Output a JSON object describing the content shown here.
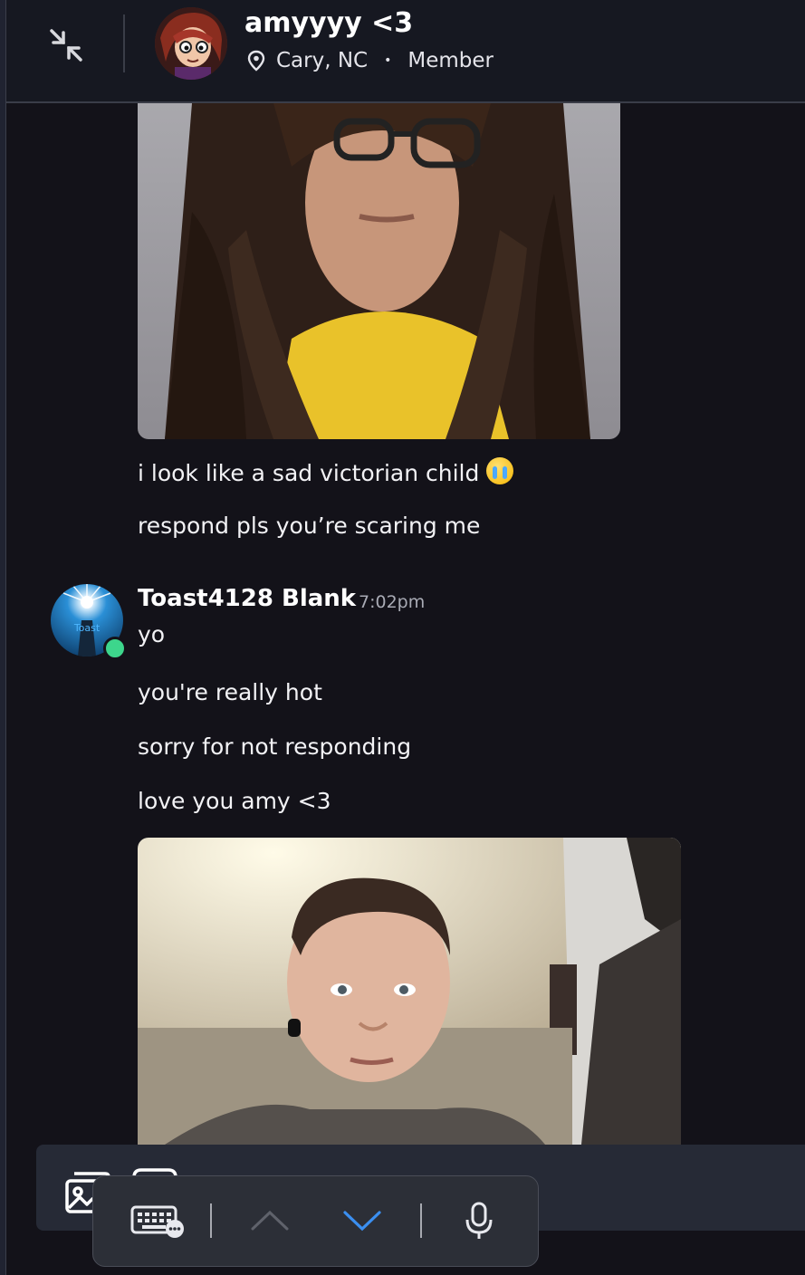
{
  "header": {
    "name": "amyyyy <3",
    "location": "Cary, NC",
    "separator": "•",
    "role": "Member"
  },
  "messages_top": [
    {
      "text": "i look like a sad victorian child",
      "emoji": "loudly-crying-face"
    },
    {
      "text": "respond pls you’re scaring me"
    }
  ],
  "toast": {
    "name": "Toast4128 Blank",
    "time": "7:02pm",
    "status": "online",
    "messages": [
      "yo",
      "you're really hot",
      "sorry for not responding",
      "love you amy <3"
    ]
  },
  "colors": {
    "background": "#131219",
    "header": "#161821",
    "online": "#3dd68c",
    "accent_blue": "#3b8ff0",
    "toolbar": "#2c2f37"
  },
  "keyboard_toolbar": {
    "icons": [
      "keyboard-icon",
      "chevron-up-icon",
      "chevron-down-icon",
      "microphone-icon"
    ]
  }
}
